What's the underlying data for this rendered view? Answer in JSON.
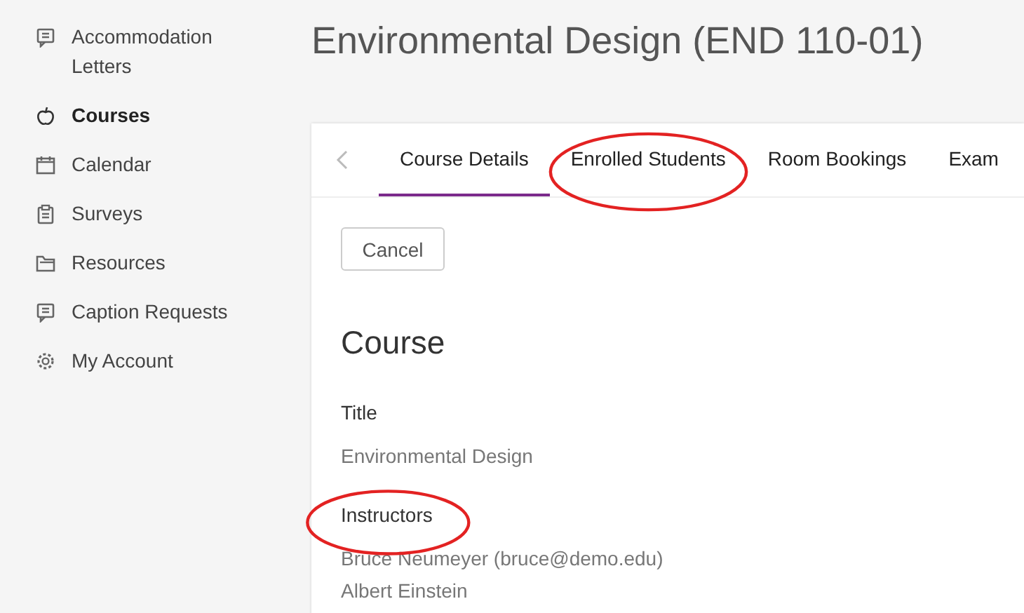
{
  "sidebar": {
    "items": [
      {
        "label": "Accommodation Letters",
        "selected": false
      },
      {
        "label": "Courses",
        "selected": true
      },
      {
        "label": "Calendar",
        "selected": false
      },
      {
        "label": "Surveys",
        "selected": false
      },
      {
        "label": "Resources",
        "selected": false
      },
      {
        "label": "Caption Requests",
        "selected": false
      },
      {
        "label": "My Account",
        "selected": false
      }
    ]
  },
  "page": {
    "title": "Environmental Design (END 110-01)"
  },
  "tabs": [
    {
      "label": "Course Details",
      "selected": true,
      "circled": false
    },
    {
      "label": "Enrolled Students",
      "selected": false,
      "circled": true
    },
    {
      "label": "Room Bookings",
      "selected": false,
      "circled": false
    },
    {
      "label": "Exam",
      "selected": false,
      "circled": false
    }
  ],
  "cancel_button": "Cancel",
  "section": {
    "heading": "Course",
    "fields": [
      {
        "label": "Title",
        "circled": false,
        "values": [
          "Environmental Design"
        ]
      },
      {
        "label": "Instructors",
        "circled": true,
        "values": [
          "Bruce Neumeyer (bruce@demo.edu)",
          "Albert Einstein"
        ]
      }
    ]
  }
}
